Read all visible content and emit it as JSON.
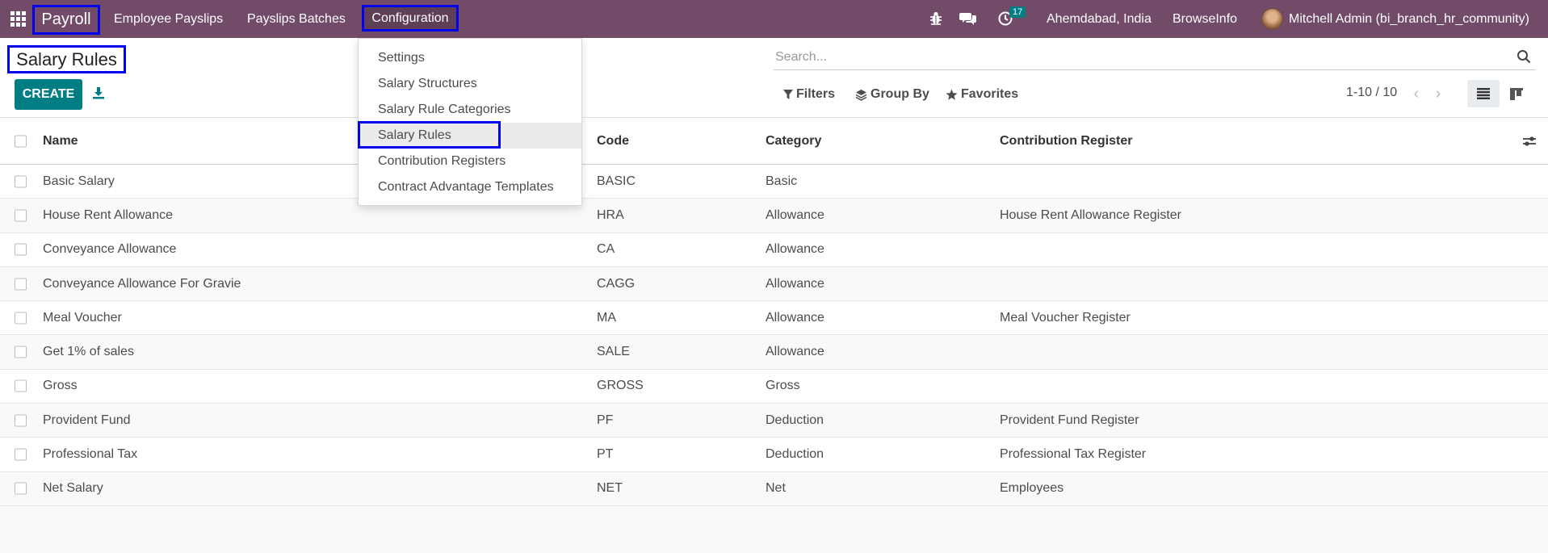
{
  "navbar": {
    "app_title": "Payroll",
    "menu": [
      "Employee Payslips",
      "Payslips Batches",
      "Configuration"
    ],
    "activity_count": "17",
    "company": "Ahemdabad, India",
    "website": "BrowseInfo",
    "user": "Mitchell Admin (bi_branch_hr_community)",
    "colors": {
      "primary": "#714b67",
      "accent": "#017e84"
    }
  },
  "dropdown": {
    "items": [
      "Settings",
      "Salary Structures",
      "Salary Rule Categories",
      "Salary Rules",
      "Contribution Registers",
      "Contract Advantage Templates"
    ],
    "active_item": "Salary Rules"
  },
  "control_panel": {
    "title": "Salary Rules",
    "create_label": "CREATE",
    "search_placeholder": "Search...",
    "filters_label": "Filters",
    "group_by_label": "Group By",
    "favorites_label": "Favorites",
    "pager": "1-10 / 10"
  },
  "list": {
    "columns": [
      "Name",
      "Code",
      "Category",
      "Contribution Register"
    ],
    "rows": [
      [
        "Basic Salary",
        "BASIC",
        "Basic",
        ""
      ],
      [
        "House Rent Allowance",
        "HRA",
        "Allowance",
        "House Rent Allowance Register"
      ],
      [
        "Conveyance Allowance",
        "CA",
        "Allowance",
        ""
      ],
      [
        "Conveyance Allowance For Gravie",
        "CAGG",
        "Allowance",
        ""
      ],
      [
        "Meal Voucher",
        "MA",
        "Allowance",
        "Meal Voucher Register"
      ],
      [
        "Get 1% of sales",
        "SALE",
        "Allowance",
        ""
      ],
      [
        "Gross",
        "GROSS",
        "Gross",
        ""
      ],
      [
        "Provident Fund",
        "PF",
        "Deduction",
        "Provident Fund Register"
      ],
      [
        "Professional Tax",
        "PT",
        "Deduction",
        "Professional Tax Register"
      ],
      [
        "Net Salary",
        "NET",
        "Net",
        "Employees"
      ]
    ]
  }
}
